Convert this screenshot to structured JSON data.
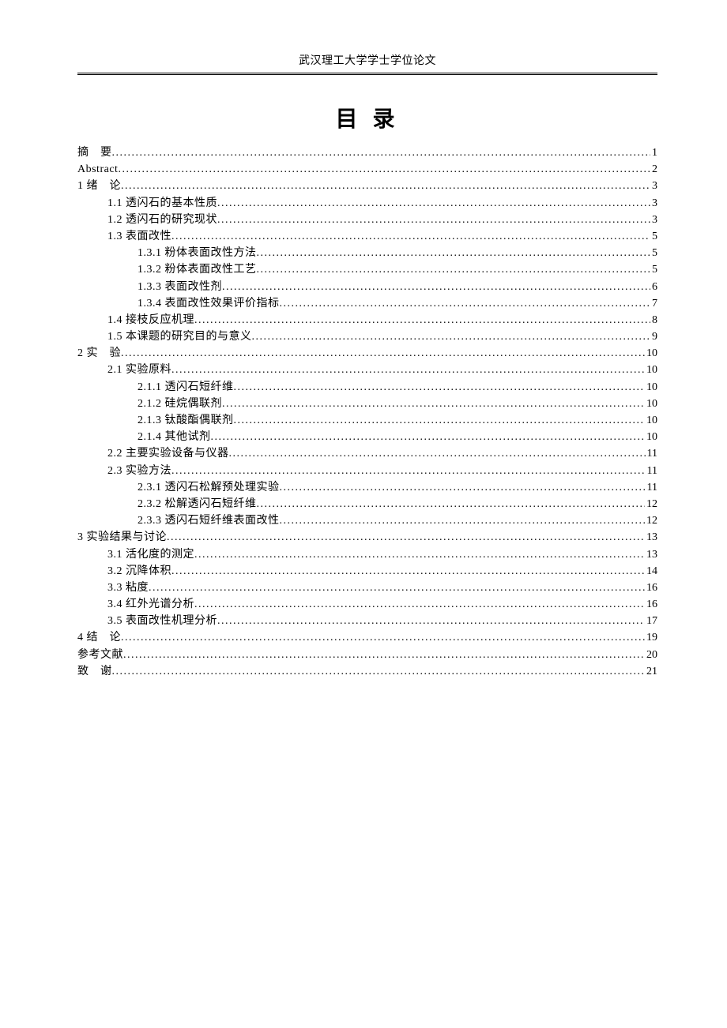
{
  "running_head": "武汉理工大学学士学位论文",
  "title": "目 录",
  "toc": [
    {
      "level": 0,
      "label": "摘　要",
      "page": "1"
    },
    {
      "level": 0,
      "label": "Abstract",
      "page": "2"
    },
    {
      "level": 0,
      "label": "1 绪　论",
      "page": "3"
    },
    {
      "level": 1,
      "label": "1.1 透闪石的基本性质",
      "page": "3"
    },
    {
      "level": 1,
      "label": "1.2 透闪石的研究现状",
      "page": "3"
    },
    {
      "level": 1,
      "label": "1.3 表面改性",
      "page": "5"
    },
    {
      "level": 2,
      "label": "1.3.1 粉体表面改性方法",
      "page": "5"
    },
    {
      "level": 2,
      "label": "1.3.2 粉体表面改性工艺",
      "page": "5"
    },
    {
      "level": 2,
      "label": "1.3.3 表面改性剂",
      "page": "6"
    },
    {
      "level": 2,
      "label": "1.3.4 表面改性效果评价指标",
      "page": "7"
    },
    {
      "level": 1,
      "label": "1.4 接枝反应机理",
      "page": "8"
    },
    {
      "level": 1,
      "label": "1.5 本课题的研究目的与意义",
      "page": "9"
    },
    {
      "level": 0,
      "label": "2 实　验",
      "page": "10"
    },
    {
      "level": 1,
      "label": "2.1 实验原料",
      "page": "10"
    },
    {
      "level": 2,
      "label": "2.1.1 透闪石短纤维",
      "page": "10"
    },
    {
      "level": 2,
      "label": "2.1.2 硅烷偶联剂",
      "page": "10"
    },
    {
      "level": 2,
      "label": "2.1.3 钛酸酯偶联剂",
      "page": "10"
    },
    {
      "level": 2,
      "label": "2.1.4 其他试剂",
      "page": "10"
    },
    {
      "level": 1,
      "label": "2.2 主要实验设备与仪器",
      "page": "11"
    },
    {
      "level": 1,
      "label": "2.3 实验方法",
      "page": "11"
    },
    {
      "level": 2,
      "label": "2.3.1 透闪石松解预处理实验",
      "page": "11"
    },
    {
      "level": 2,
      "label": "2.3.2 松解透闪石短纤维",
      "page": "12"
    },
    {
      "level": 2,
      "label": "2.3.3 透闪石短纤维表面改性",
      "page": "12"
    },
    {
      "level": 0,
      "label": "3 实验结果与讨论",
      "page": "13"
    },
    {
      "level": 1,
      "label": "3.1 活化度的测定",
      "page": "13"
    },
    {
      "level": 1,
      "label": "3.2 沉降体积",
      "page": "14"
    },
    {
      "level": 1,
      "label": "3.3 粘度",
      "page": "16"
    },
    {
      "level": 1,
      "label": "3.4 红外光谱分析",
      "page": "16"
    },
    {
      "level": 1,
      "label": "3.5 表面改性机理分析",
      "page": "17"
    },
    {
      "level": 0,
      "label": "4 结　论",
      "page": "19"
    },
    {
      "level": 0,
      "label": "参考文献",
      "page": "20"
    },
    {
      "level": 0,
      "label": "致　谢",
      "page": "21"
    }
  ]
}
